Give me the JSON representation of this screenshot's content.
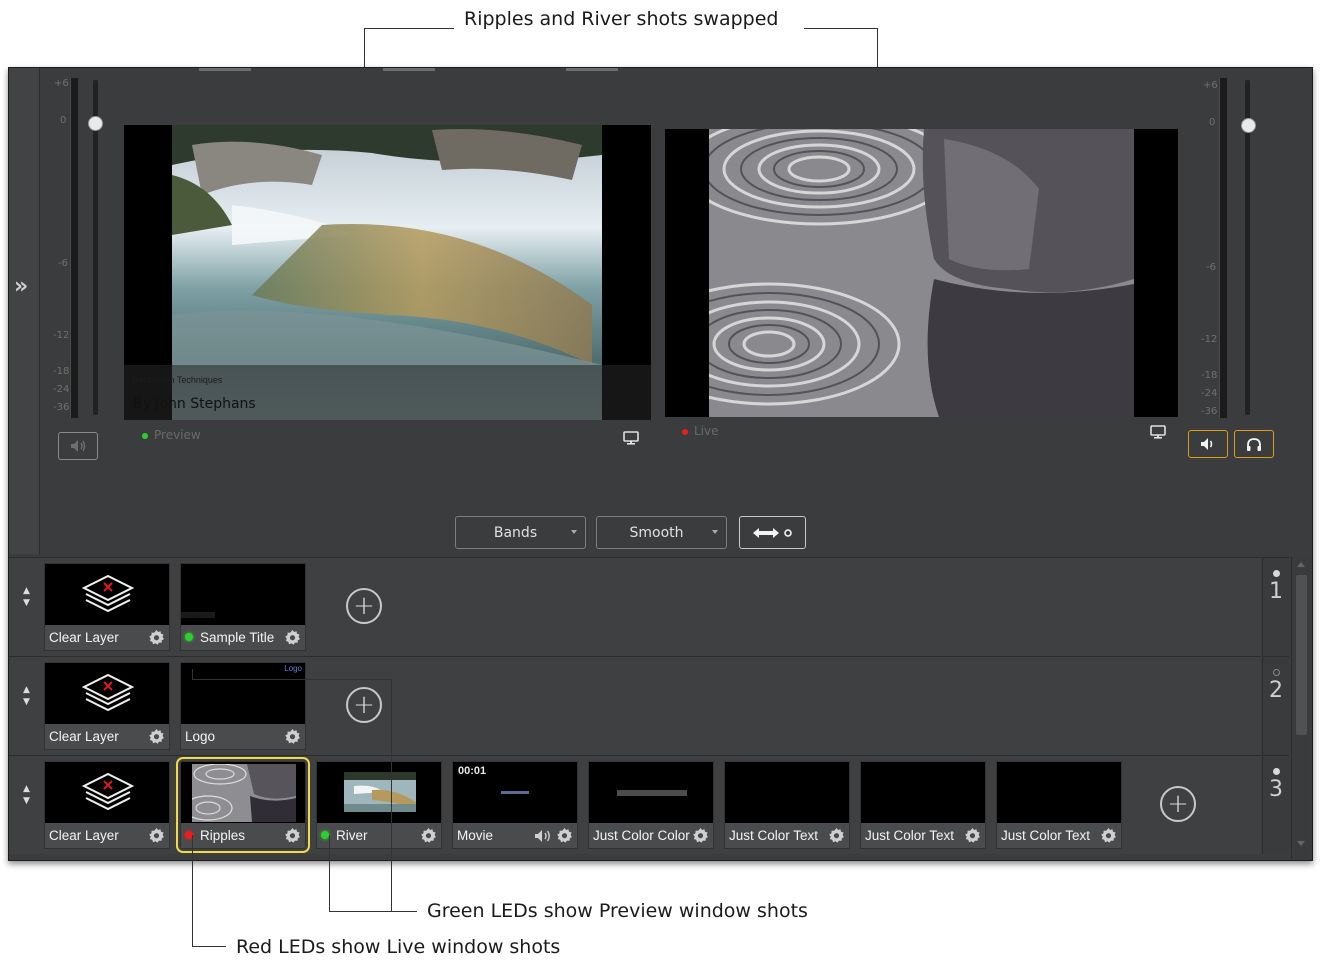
{
  "annotations": {
    "top": "Ripples and River shots swapped",
    "green": "Green LEDs show Preview window shots",
    "red": "Red LEDs show Live window shots"
  },
  "meter_scale": [
    "+6",
    "0",
    "-6",
    "-12",
    "-18",
    "-24",
    "-36"
  ],
  "preview": {
    "label": "Preview",
    "overlay_small": "Relaxation Techniques",
    "overlay_large": "By John Stephans"
  },
  "live": {
    "label": "Live"
  },
  "transition": {
    "type": "Bands",
    "speed": "Smooth"
  },
  "layers": [
    {
      "number": "1",
      "shots": [
        {
          "label": "Clear Layer",
          "icon": "layers-clear-icon"
        },
        {
          "label": "Sample Title",
          "led": "green"
        }
      ]
    },
    {
      "number": "2",
      "shots": [
        {
          "label": "Clear Layer",
          "icon": "layers-clear-icon"
        },
        {
          "label": "Logo",
          "thumb_text": "Logo"
        }
      ]
    },
    {
      "number": "3",
      "shots": [
        {
          "label": "Clear Layer",
          "icon": "layers-clear-icon"
        },
        {
          "label": "Ripples",
          "led": "red",
          "selected": true
        },
        {
          "label": "River",
          "led": "green"
        },
        {
          "label": "Movie",
          "timecode": "00:01"
        },
        {
          "label": "Just Color Color"
        },
        {
          "label": "Just Color Text"
        },
        {
          "label": "Just Color Text"
        },
        {
          "label": "Just Color Text"
        }
      ]
    }
  ],
  "colors": {
    "accent": "#e09b1a",
    "selection": "#f2d94a",
    "led_green": "#2bd12b",
    "led_red": "#ee1c1c"
  }
}
